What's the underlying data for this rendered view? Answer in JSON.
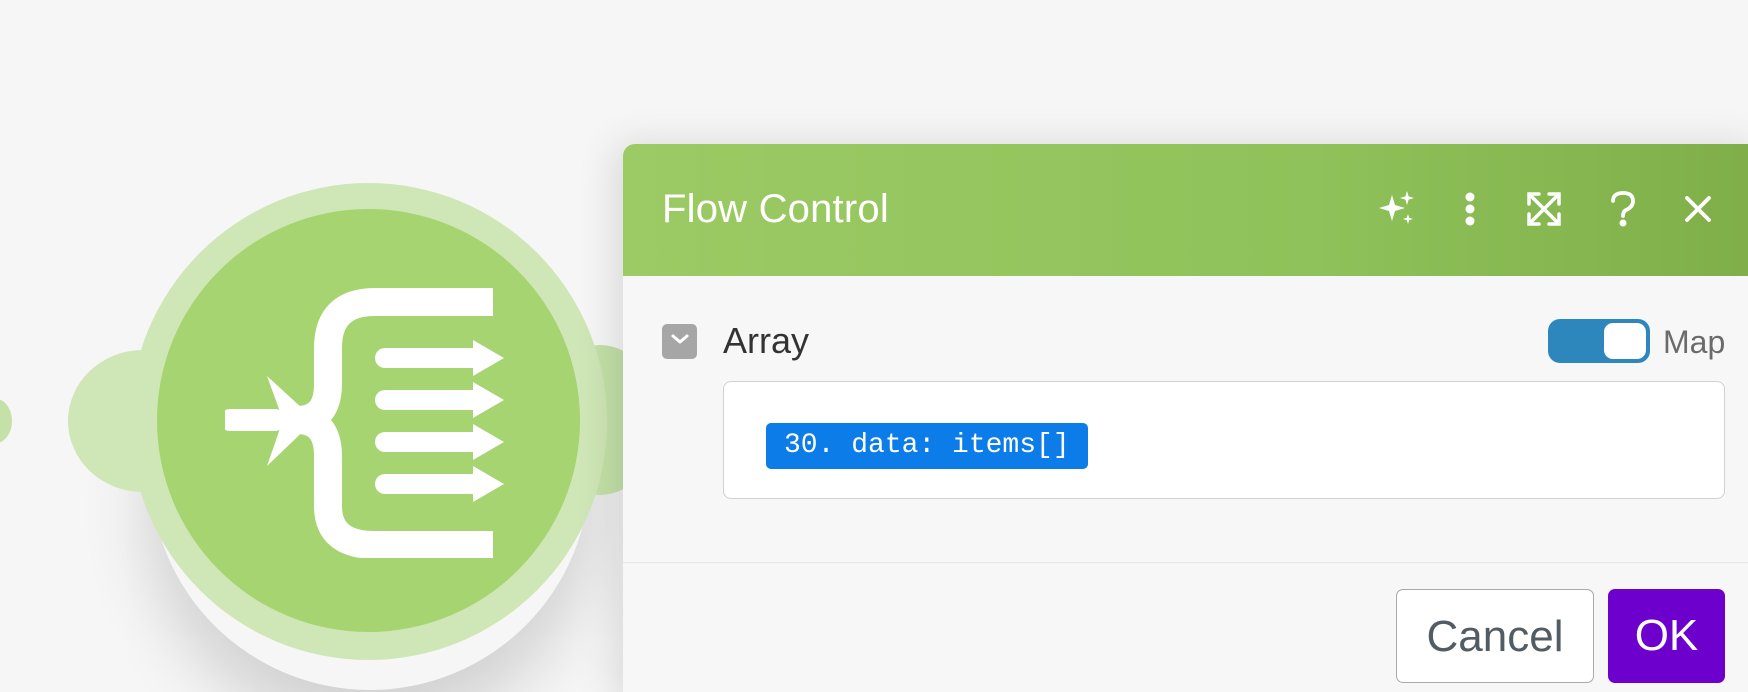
{
  "module": {
    "icon": "iterator-icon",
    "colors": {
      "node_outer": "#cfe6b6",
      "node_inner": "#a5d470"
    }
  },
  "panel": {
    "title": "Flow Control",
    "header_color": "#8fc25a",
    "header_actions": [
      {
        "name": "ai-sparkle-icon",
        "label": "AI assistant"
      },
      {
        "name": "more-options-icon",
        "label": "More options"
      },
      {
        "name": "expand-icon",
        "label": "Maximize"
      },
      {
        "name": "help-icon",
        "label": "Help"
      },
      {
        "name": "close-icon",
        "label": "Close"
      }
    ],
    "field": {
      "label": "Array",
      "map_toggle_label": "Map",
      "map_toggle_on": true,
      "mapped_value": "30. data: items[]",
      "mapped_pill_color": "#0b7ce8"
    },
    "buttons": {
      "cancel": "Cancel",
      "ok": "OK",
      "ok_color": "#6d00cc"
    }
  }
}
